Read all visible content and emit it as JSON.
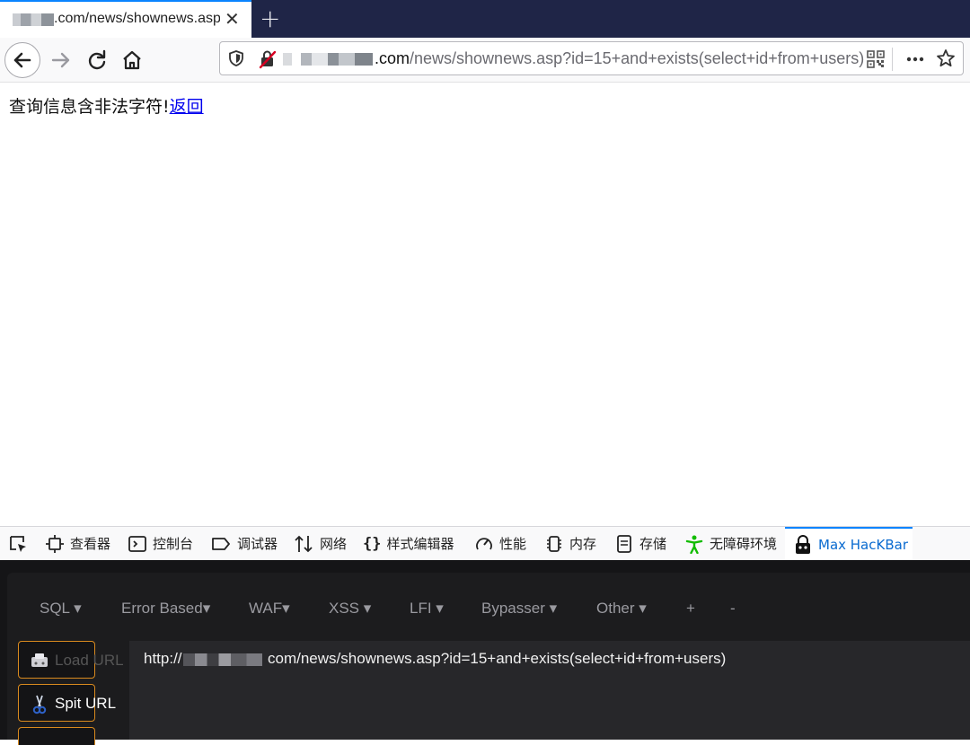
{
  "browser": {
    "tab": {
      "title": ".com/news/shownews.asp",
      "close_glyph": "✕",
      "new_tab_glyph": "+"
    },
    "url": {
      "domain": ".com",
      "path": "/news/shownews.asp?id=15+and+exists(select+id+from+users)"
    }
  },
  "page": {
    "message": "查询信息含非法字符!",
    "link": "返回"
  },
  "devtools": {
    "tabs": [
      {
        "label": "查看器",
        "icon": "inspector-icon"
      },
      {
        "label": "控制台",
        "icon": "console-icon"
      },
      {
        "label": "调试器",
        "icon": "debugger-icon"
      },
      {
        "label": "网络",
        "icon": "network-icon"
      },
      {
        "label": "样式编辑器",
        "icon": "style-editor-icon"
      },
      {
        "label": "性能",
        "icon": "performance-icon"
      },
      {
        "label": "内存",
        "icon": "memory-icon"
      },
      {
        "label": "存储",
        "icon": "storage-icon"
      },
      {
        "label": "无障碍环境",
        "icon": "accessibility-icon"
      },
      {
        "label": "Max HacKBar",
        "icon": "hackbar-icon"
      }
    ],
    "active_tab": "Max HacKBar",
    "accent": "#0a84ff"
  },
  "hackbar": {
    "menu": [
      "SQL",
      "Error Based",
      "WAF",
      "XSS",
      "LFI",
      "Bypasser",
      "Other",
      "+",
      "-"
    ],
    "load_url": "Load URL",
    "split_url": "Spit URL",
    "url_prefix": "http://",
    "url_suffix": " com/news/shownews.asp?id=15+and+exists(select+id+from+users)",
    "button_border": "#d98a1e"
  }
}
